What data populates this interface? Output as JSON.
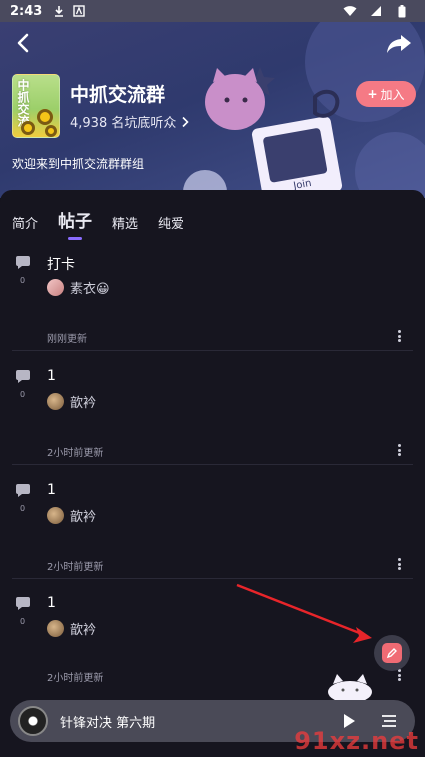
{
  "status_bar": {
    "time": "2:43"
  },
  "header": {
    "group_name": "中抓交流群",
    "cover_text": "中抓交流",
    "stats": "4,938 名坑底听众",
    "join_label": "加入",
    "join_plus": "+",
    "description": "欢迎来到中抓交流群群组",
    "art_label": "Join"
  },
  "tabs": [
    {
      "label": "简介"
    },
    {
      "label": "帖子"
    },
    {
      "label": "精选"
    },
    {
      "label": "纯爱"
    }
  ],
  "posts": [
    {
      "title": "打卡",
      "author": "素衣😀",
      "comments": "0",
      "updated": "刚刚更新"
    },
    {
      "title": "1",
      "author": "歆衿",
      "comments": "0",
      "updated": "2小时前更新"
    },
    {
      "title": "1",
      "author": "歆衿",
      "comments": "0",
      "updated": "2小时前更新"
    },
    {
      "title": "1",
      "author": "歆衿",
      "comments": "0",
      "updated": "2小时前更新"
    }
  ],
  "player": {
    "title": "针锋对决 第六期"
  },
  "watermark": "91xz.net",
  "colors": {
    "accent": "#8a6cff",
    "join": "#f57a85",
    "fab": "#f06b74",
    "arrow": "#e8252a"
  }
}
